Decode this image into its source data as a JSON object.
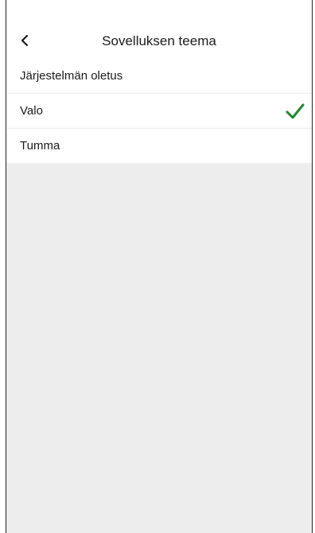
{
  "header": {
    "title": "Sovelluksen teema",
    "back_icon": "chevron-left-icon"
  },
  "theme_options": [
    {
      "label": "Järjestelmän oletus",
      "selected": false
    },
    {
      "label": "Valo",
      "selected": true
    },
    {
      "label": "Tumma",
      "selected": false
    }
  ],
  "selected_icon": "checkmark-icon",
  "colors": {
    "accent_check": "#1e8a2e",
    "list_background": "#ffffff",
    "page_background": "#ededed"
  }
}
